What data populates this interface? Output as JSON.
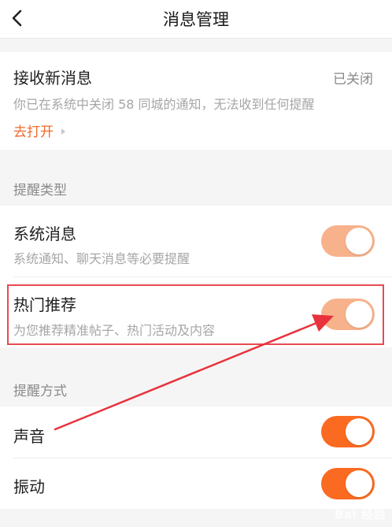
{
  "header": {
    "title": "消息管理"
  },
  "receive": {
    "title": "接收新消息",
    "status": "已关闭",
    "description": "你已在系统中关闭 58 同城的通知，无法收到任何提醒",
    "link": "去打开"
  },
  "reminder_types": {
    "label": "提醒类型",
    "items": [
      {
        "title": "系统消息",
        "description": "系统通知、聊天消息等必要提醒",
        "on": true
      },
      {
        "title": "热门推荐",
        "description": "为您推荐精准帖子、热门活动及内容",
        "on": true
      }
    ]
  },
  "reminder_methods": {
    "label": "提醒方式",
    "items": [
      {
        "title": "声音",
        "on": true
      },
      {
        "title": "振动",
        "on": true
      }
    ]
  },
  "watermark": "Bai 经验",
  "colors": {
    "accent": "#f06a2c",
    "toggle_disabled": "#f7b28c",
    "toggle_active": "#fb6a21",
    "highlight": "#e84a52",
    "annotation_arrow": "#e8323c"
  }
}
